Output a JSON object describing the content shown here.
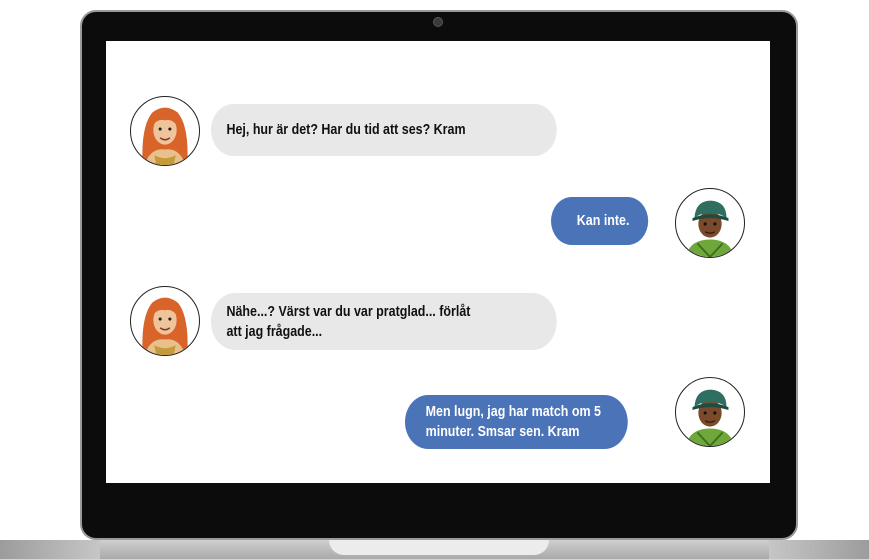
{
  "conversation": {
    "messages": [
      {
        "sender": "girl",
        "direction": "received",
        "text": "Hej, hur är det? Har du tid att ses? Kram"
      },
      {
        "sender": "boy",
        "direction": "sent",
        "text": "Kan inte."
      },
      {
        "sender": "girl",
        "direction": "received",
        "text": "Nähe...? Värst var du var pratglad... förlåt\natt jag frågade..."
      },
      {
        "sender": "boy",
        "direction": "sent",
        "text": "Men lugn, jag har match om 5\nminuter. Smsar sen. Kram"
      }
    ]
  },
  "colors": {
    "received_bubble": "#e8e8e8",
    "sent_bubble": "#4a73b8",
    "laptop_bezel": "#0c0c0c",
    "girl_hair": "#d9642a",
    "boy_cap": "#2f6f62",
    "boy_jacket": "#6fa83a"
  },
  "avatars": {
    "girl": "girl-avatar-illustration",
    "boy": "boy-avatar-illustration"
  }
}
